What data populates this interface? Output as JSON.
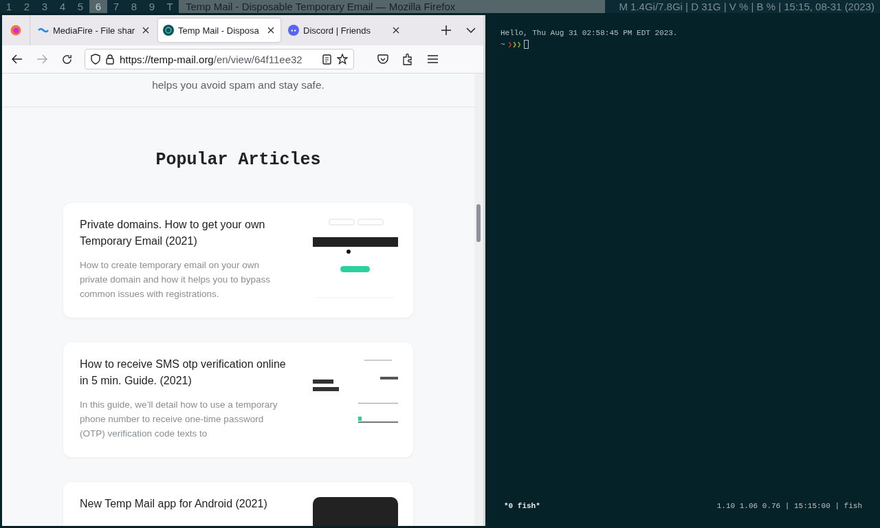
{
  "top_bar": {
    "workspaces": [
      {
        "label": "1",
        "selected": false
      },
      {
        "label": "2",
        "selected": false
      },
      {
        "label": "3",
        "selected": false
      },
      {
        "label": "4",
        "selected": false
      },
      {
        "label": "5",
        "selected": false
      },
      {
        "label": "6",
        "selected": true
      },
      {
        "label": "7",
        "selected": false
      },
      {
        "label": "8",
        "selected": false
      },
      {
        "label": "9",
        "selected": false
      },
      {
        "label": "T",
        "selected": false
      }
    ],
    "window_title": "Temp Mail - Disposable Temporary Email — Mozilla Firefox",
    "status": "M 1.4Gi/7.8Gi | D 31G | V % | B % | 15:15, 08-31 (2023)"
  },
  "browser": {
    "tabs": [
      {
        "label": "MediaFire - File shar",
        "selected": false
      },
      {
        "label": "Temp Mail - Disposa",
        "selected": true
      },
      {
        "label": "Discord | Friends",
        "selected": false
      }
    ],
    "url_host": "https://temp-mail.org",
    "url_path": "/en/view/64f11ee32",
    "page": {
      "intro_tail": "helps you avoid spam and stay safe.",
      "heading": "Popular Articles",
      "articles": [
        {
          "title": "Private domains. How to get your own Temporary Email (2021)",
          "summary": "How to create temporary email on your own private domain and how it helps you to bypass common issues with registrations."
        },
        {
          "title": "How to receive SMS otp verification online in 5 min. Guide. (2021)",
          "summary": "In this guide, we’ll detail how to use a temporary phone number to receive one-time password (OTP) verification code texts to"
        },
        {
          "title": "New Temp Mail app for Android (2021)"
        }
      ]
    }
  },
  "terminal": {
    "greeting": "Hello, Thu Aug 31 02:58:45 PM EDT 2023.",
    "prompt_dir": "~",
    "chevrons": [
      {
        "text": "❯",
        "color": "#c0392b"
      },
      {
        "text": "❯",
        "color": "#d4a017"
      },
      {
        "text": "❯",
        "color": "#7fae2f"
      }
    ],
    "status_left": "*0 fish*",
    "status_right": "1.10 1.06 0.76 | 15:15:00 | fish"
  }
}
